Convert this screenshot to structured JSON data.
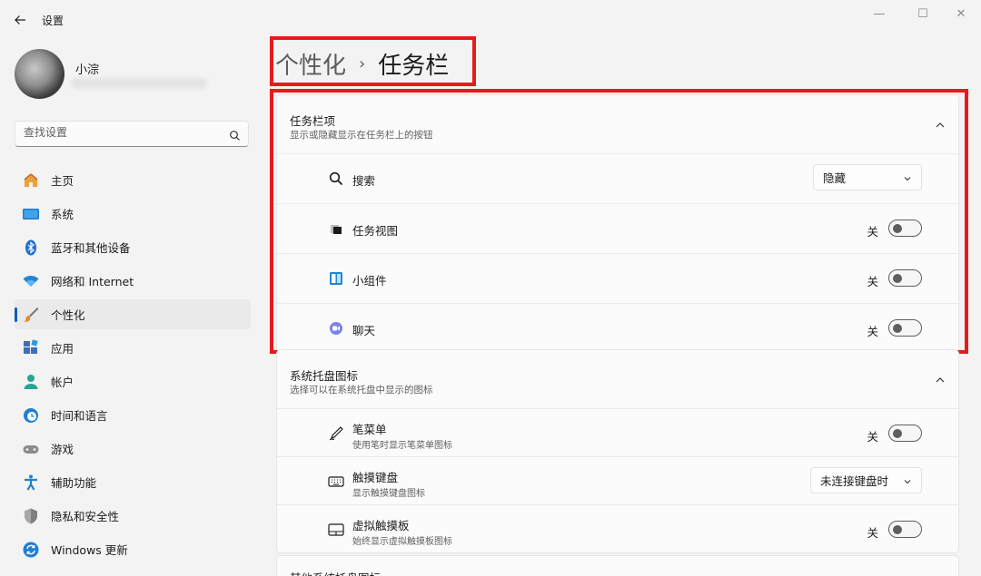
{
  "app": {
    "title": "设置"
  },
  "window_controls": {
    "minimize": "—",
    "maximize": "☐",
    "close": "✕"
  },
  "user": {
    "name": "小淙"
  },
  "search": {
    "placeholder": "查找设置"
  },
  "sidebar": {
    "items": [
      {
        "label": "主页",
        "icon": "home-icon",
        "active": false
      },
      {
        "label": "系统",
        "icon": "display-icon",
        "active": false
      },
      {
        "label": "蓝牙和其他设备",
        "icon": "bluetooth-icon",
        "active": false
      },
      {
        "label": "网络和 Internet",
        "icon": "wifi-icon",
        "active": false
      },
      {
        "label": "个性化",
        "icon": "brush-icon",
        "active": true
      },
      {
        "label": "应用",
        "icon": "apps-icon",
        "active": false
      },
      {
        "label": "帐户",
        "icon": "account-icon",
        "active": false
      },
      {
        "label": "时间和语言",
        "icon": "clock-globe-icon",
        "active": false
      },
      {
        "label": "游戏",
        "icon": "gamepad-icon",
        "active": false
      },
      {
        "label": "辅助功能",
        "icon": "accessibility-icon",
        "active": false
      },
      {
        "label": "隐私和安全性",
        "icon": "shield-icon",
        "active": false
      },
      {
        "label": "Windows 更新",
        "icon": "update-icon",
        "active": false
      }
    ]
  },
  "breadcrumb": {
    "parent": "个性化",
    "separator": "›",
    "current": "任务栏"
  },
  "taskbar_items": {
    "title": "任务栏项",
    "subtitle": "显示或隐藏显示在任务栏上的按钮",
    "rows": [
      {
        "label": "搜索",
        "icon": "search-icon",
        "control": "dropdown",
        "value": "隐藏"
      },
      {
        "label": "任务视图",
        "icon": "task-view-icon",
        "control": "toggle",
        "state": "关"
      },
      {
        "label": "小组件",
        "icon": "widgets-icon",
        "control": "toggle",
        "state": "关"
      },
      {
        "label": "聊天",
        "icon": "chat-icon",
        "control": "toggle",
        "state": "关"
      }
    ]
  },
  "system_tray": {
    "title": "系统托盘图标",
    "subtitle": "选择可以在系统托盘中显示的图标",
    "rows": [
      {
        "label": "笔菜单",
        "sub": "使用笔时显示笔菜单图标",
        "icon": "pen-icon",
        "control": "toggle",
        "state": "关"
      },
      {
        "label": "触摸键盘",
        "sub": "显示触摸键盘图标",
        "icon": "keyboard-icon",
        "control": "dropdown",
        "value": "未连接键盘时"
      },
      {
        "label": "虚拟触摸板",
        "sub": "始终显示虚拟触摸板图标",
        "icon": "touchpad-icon",
        "control": "toggle",
        "state": "关"
      }
    ]
  },
  "other_tray": {
    "title": "其他系统托盘图标"
  },
  "colors": {
    "accent": "#005fb8",
    "highlight": "#e61b1b"
  }
}
